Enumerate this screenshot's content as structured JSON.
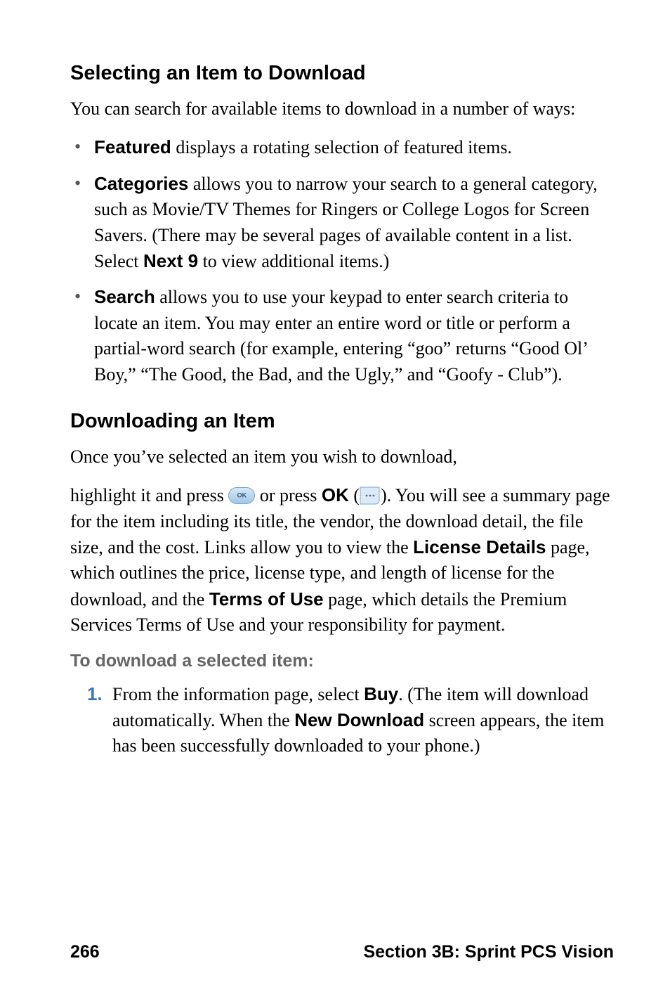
{
  "section1": {
    "heading": "Selecting an Item to Download",
    "intro": "You can search for available items to download in a number of ways:",
    "bullets": [
      {
        "label": "Featured",
        "text": " displays a rotating selection of featured items."
      },
      {
        "label": "Categories",
        "text_a": " allows you to narrow your search to a general category, such as Movie/TV Themes for Ringers or College Logos for Screen Savers. (There may be several pages of available content in a list. Select ",
        "label2": "Next 9",
        "text_b": " to view additional items.)"
      },
      {
        "label": "Search",
        "text": " allows you to use your keypad to enter search criteria to locate an item. You may enter an entire word or title or perform a partial-word search (for example, entering “goo” returns “Good Ol’ Boy,” “The Good, the Bad, and the Ugly,” and “Goofy - Club”)."
      }
    ]
  },
  "section2": {
    "heading": "Downloading an Item",
    "para1": "Once you’ve selected an item you wish to download,",
    "para2_a": "highlight it and press ",
    "para2_b": " or press ",
    "ok_label": "OK",
    "para2_c": " (",
    "para2_d": "). You will see a summary page for the item including its title, the vendor, the download detail, the file size, and the cost. Links allow you to view the ",
    "license_label": "License Details",
    "para2_e": " page, which outlines the price, license type, and length of license for the download, and the ",
    "terms_label": "Terms of Use",
    "para2_f": " page, which details the Premium Services Terms of Use and your responsibility for payment.",
    "subheading": "To download a selected item:",
    "step1_a": "From the information page, select ",
    "buy_label": "Buy",
    "step1_b": ". (The item will download automatically. When the ",
    "newdl_label": "New Download",
    "step1_c": " screen appears, the item has been successfully downloaded to your phone.)"
  },
  "footer": {
    "page": "266",
    "section": "Section 3B: Sprint PCS Vision"
  }
}
